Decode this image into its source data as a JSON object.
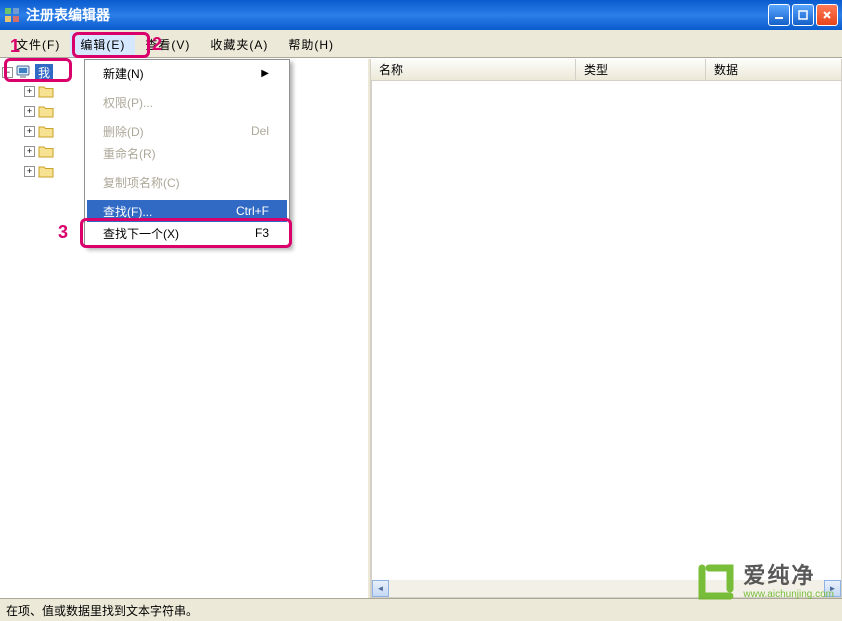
{
  "window": {
    "title": "注册表编辑器"
  },
  "menubar": {
    "items": [
      {
        "label": "文件(F)"
      },
      {
        "label": "编辑(E)"
      },
      {
        "label": "查看(V)"
      },
      {
        "label": "收藏夹(A)"
      },
      {
        "label": "帮助(H)"
      }
    ]
  },
  "tree": {
    "root_label": "我",
    "children_count": 5
  },
  "dropdown": {
    "items": [
      {
        "label": "新建(N)",
        "shortcut": "",
        "submenu": true,
        "disabled": false
      },
      {
        "sep": true
      },
      {
        "label": "权限(P)...",
        "shortcut": "",
        "disabled": true
      },
      {
        "sep": true
      },
      {
        "label": "删除(D)",
        "shortcut": "Del",
        "disabled": true
      },
      {
        "label": "重命名(R)",
        "shortcut": "",
        "disabled": true
      },
      {
        "sep": true
      },
      {
        "label": "复制项名称(C)",
        "shortcut": "",
        "disabled": true
      },
      {
        "sep": true
      },
      {
        "label": "查找(F)...",
        "shortcut": "Ctrl+F",
        "disabled": false,
        "highlight": true
      },
      {
        "label": "查找下一个(X)",
        "shortcut": "F3",
        "disabled": false
      }
    ]
  },
  "list": {
    "columns": [
      "名称",
      "类型",
      "数据"
    ]
  },
  "status": {
    "text": "在项、值或数据里找到文本字符串。"
  },
  "annotations": {
    "badge1": "1",
    "badge2": "2",
    "badge3": "3"
  },
  "watermark": {
    "brand_cn": "爱纯净",
    "brand_en": "www.aichunjing.com"
  }
}
